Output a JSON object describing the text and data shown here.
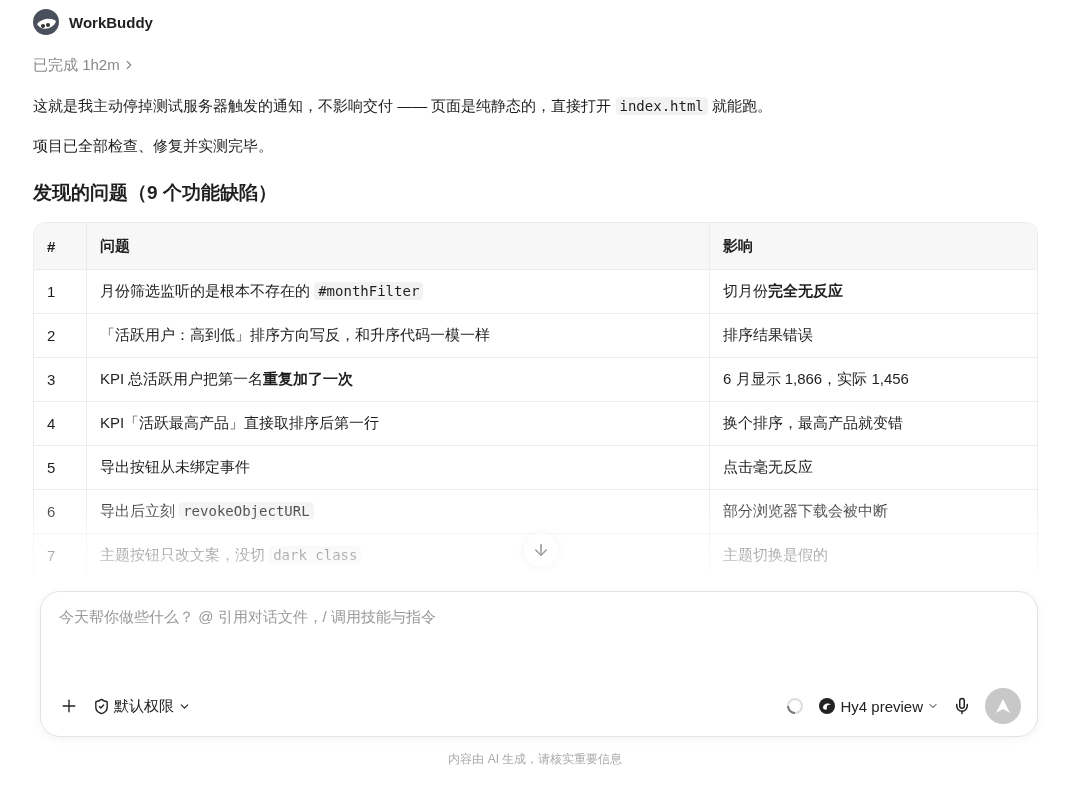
{
  "header": {
    "name": "WorkBuddy"
  },
  "status": {
    "text": "已完成 1h2m"
  },
  "paragraphs": [
    [
      {
        "kind": "text",
        "text": "这就是我主动停掉测试服务器触发的通知，不影响交付 —— 页面是纯静态的，直接打开 "
      },
      {
        "kind": "code",
        "text": "index.html"
      },
      {
        "kind": "text",
        "text": " 就能跑。"
      }
    ],
    [
      {
        "kind": "text",
        "text": "项目已全部检查、修复并实测完毕。"
      }
    ]
  ],
  "heading": "发现的问题（9 个功能缺陷）",
  "table": {
    "columns": [
      "#",
      "问题",
      "影响"
    ],
    "rows": [
      [
        [
          {
            "kind": "text",
            "text": "1"
          }
        ],
        [
          {
            "kind": "text",
            "text": "月份筛选监听的是根本不存在的 "
          },
          {
            "kind": "code",
            "text": "#monthFilter"
          }
        ],
        [
          {
            "kind": "text",
            "text": "切月份**完全无反应**"
          }
        ]
      ],
      [
        [
          {
            "kind": "text",
            "text": "2"
          }
        ],
        [
          {
            "kind": "text",
            "text": "「活跃用户：高到低」排序方向写反，和升序代码一模一样"
          }
        ],
        [
          {
            "kind": "text",
            "text": "排序结果错误"
          }
        ]
      ],
      [
        [
          {
            "kind": "text",
            "text": "3"
          }
        ],
        [
          {
            "kind": "text",
            "text": "KPI 总活跃用户把第一名**重复加了一次**"
          }
        ],
        [
          {
            "kind": "text",
            "text": "6 月显示 1,866，实际 1,456"
          }
        ]
      ],
      [
        [
          {
            "kind": "text",
            "text": "4"
          }
        ],
        [
          {
            "kind": "text",
            "text": "KPI「活跃最高产品」直接取排序后第一行"
          }
        ],
        [
          {
            "kind": "text",
            "text": "换个排序，最高产品就变错"
          }
        ]
      ],
      [
        [
          {
            "kind": "text",
            "text": "5"
          }
        ],
        [
          {
            "kind": "text",
            "text": "导出按钮从未绑定事件"
          }
        ],
        [
          {
            "kind": "text",
            "text": "点击毫无反应"
          }
        ]
      ],
      [
        [
          {
            "kind": "text",
            "text": "6"
          }
        ],
        [
          {
            "kind": "text",
            "text": "导出后立刻 "
          },
          {
            "kind": "code",
            "text": "revokeObjectURL"
          }
        ],
        [
          {
            "kind": "text",
            "text": "部分浏览器下载会被中断"
          }
        ]
      ],
      [
        [
          {
            "kind": "text",
            "text": "7"
          }
        ],
        [
          {
            "kind": "text",
            "text": "主题按钮只改文案，没切 "
          },
          {
            "kind": "code",
            "text": "dark class"
          }
        ],
        [
          {
            "kind": "text",
            "text": "主题切换是假的"
          }
        ]
      ]
    ]
  },
  "composer": {
    "placeholder": "今天帮你做些什么？ @ 引用对话文件，/ 调用技能与指令",
    "permission": "默认权限",
    "model": "Hy4 preview",
    "send_disabled": true
  },
  "footer": "内容由 AI 生成，请核实重要信息"
}
